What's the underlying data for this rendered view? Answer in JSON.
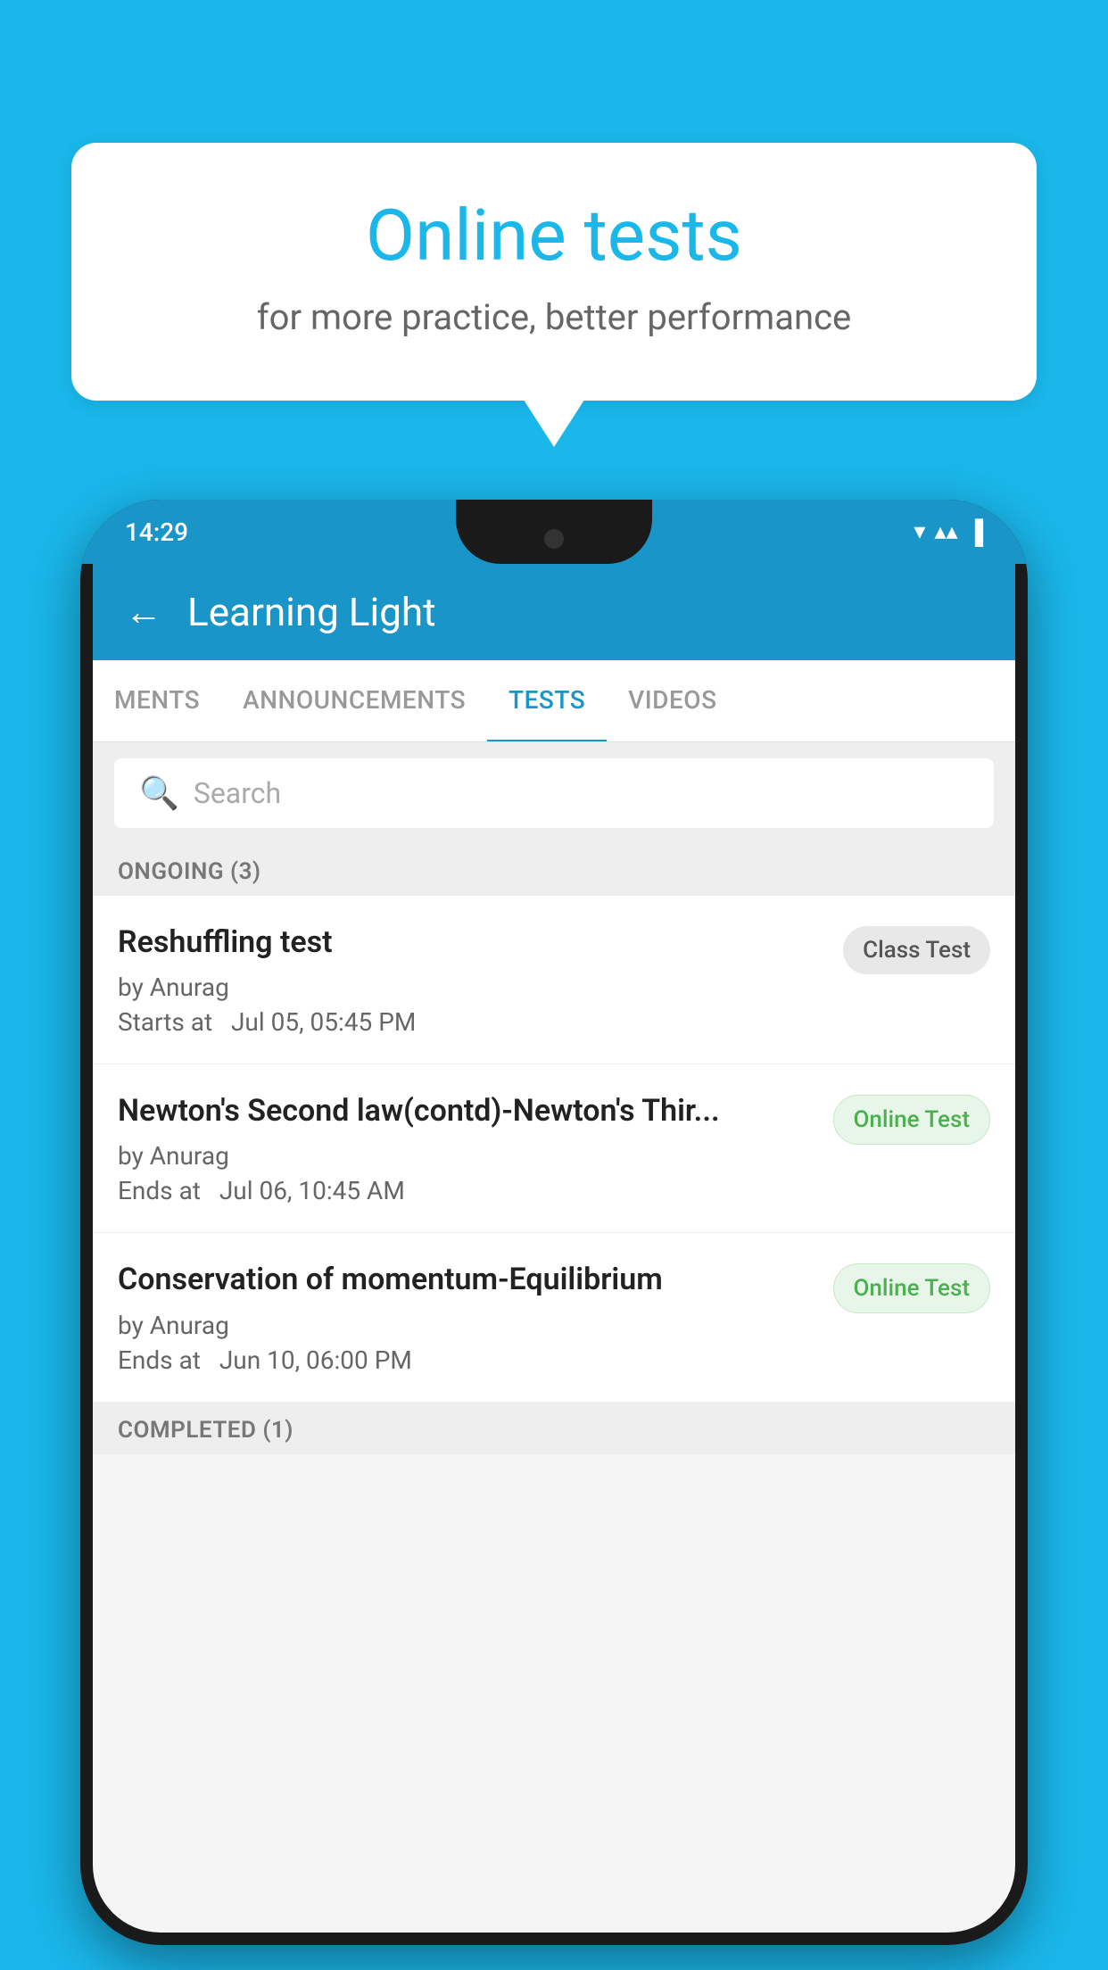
{
  "background": {
    "color": "#1ab7ea"
  },
  "speech_bubble": {
    "title": "Online tests",
    "subtitle": "for more practice, better performance"
  },
  "phone": {
    "status_bar": {
      "time": "14:29",
      "wifi_icon": "▼",
      "signal_icon": "▲",
      "battery_icon": "▐"
    },
    "app_header": {
      "back_label": "←",
      "title": "Learning Light"
    },
    "tabs": [
      {
        "label": "MENTS",
        "active": false
      },
      {
        "label": "ANNOUNCEMENTS",
        "active": false
      },
      {
        "label": "TESTS",
        "active": true
      },
      {
        "label": "VIDEOS",
        "active": false
      }
    ],
    "search": {
      "placeholder": "Search"
    },
    "ongoing_section": {
      "label": "ONGOING (3)"
    },
    "tests": [
      {
        "title": "Reshuffling test",
        "author": "by Anurag",
        "time_label": "Starts at",
        "time": "Jul 05, 05:45 PM",
        "badge": "Class Test",
        "badge_type": "class"
      },
      {
        "title": "Newton's Second law(contd)-Newton's Thir...",
        "author": "by Anurag",
        "time_label": "Ends at",
        "time": "Jul 06, 10:45 AM",
        "badge": "Online Test",
        "badge_type": "online"
      },
      {
        "title": "Conservation of momentum-Equilibrium",
        "author": "by Anurag",
        "time_label": "Ends at",
        "time": "Jun 10, 06:00 PM",
        "badge": "Online Test",
        "badge_type": "online"
      }
    ],
    "completed_section": {
      "label": "COMPLETED (1)"
    }
  }
}
